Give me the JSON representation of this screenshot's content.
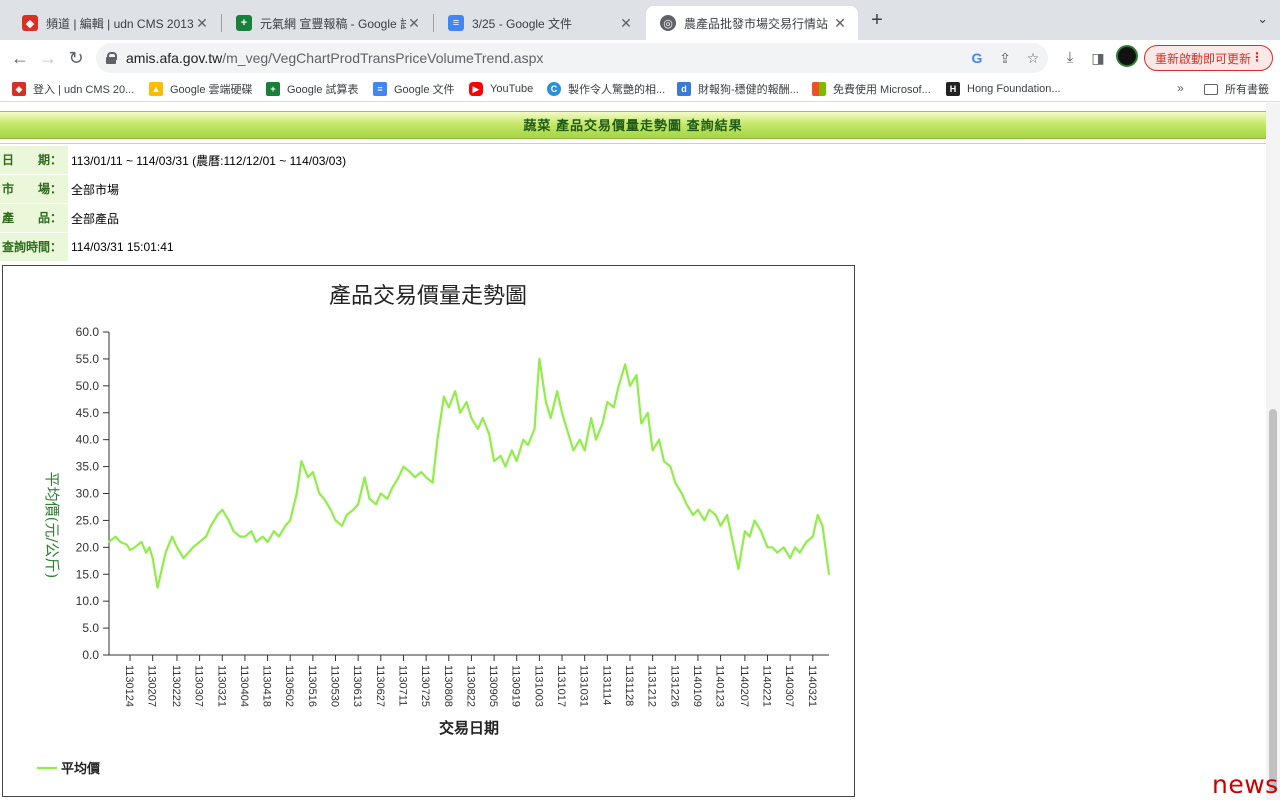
{
  "browser": {
    "tabs": [
      {
        "title": "頻道 | 編輯 | udn CMS 2013",
        "icon": "udn-icon",
        "color": "#d93025"
      },
      {
        "title": "元氣網 宣豐報稿 - Google 試算表",
        "icon": "sheets-icon",
        "color": "#188038"
      },
      {
        "title": "3/25 - Google 文件",
        "icon": "docs-icon",
        "color": "#4285f4"
      },
      {
        "title": "農產品批發市場交易行情站",
        "icon": "globe-icon",
        "color": "#5f6368"
      }
    ],
    "url_host": "amis.afa.gov.tw",
    "url_path": "/m_veg/VegChartProdTransPriceVolumeTrend.aspx",
    "update_label": "重新啟動即可更新",
    "bookmarks": [
      {
        "label": "登入 | udn CMS 20...",
        "icon": "udn-icon",
        "color": "#d93025"
      },
      {
        "label": "Google 雲端硬碟",
        "icon": "drive-icon",
        "color": "#fbbc04"
      },
      {
        "label": "Google 試算表",
        "icon": "sheets-icon",
        "color": "#188038"
      },
      {
        "label": "Google 文件",
        "icon": "docs-icon",
        "color": "#4285f4"
      },
      {
        "label": "YouTube",
        "icon": "youtube-icon",
        "color": "#ff0000"
      },
      {
        "label": "製作令人驚艷的相...",
        "icon": "canva-icon",
        "color": "#2b8fe0"
      },
      {
        "label": "財報狗-穩健的報酬...",
        "icon": "statementdog-icon",
        "color": "#3a7bd5"
      },
      {
        "label": "免費使用 Microsof...",
        "icon": "microsoft-icon",
        "color": "#f25022"
      },
      {
        "label": "Hong Foundation...",
        "icon": "hong-icon",
        "color": "#222222"
      }
    ],
    "all_bookmarks_label": "所有書籤"
  },
  "page": {
    "header": "蔬菜 產品交易價量走勢圖 查詢結果",
    "fields": [
      {
        "label": "日　　期：",
        "value": "113/01/11 ~ 114/03/31 (農曆:112/12/01 ~ 114/03/03)"
      },
      {
        "label": "市　　場：",
        "value": "全部市場"
      },
      {
        "label": "產　　品：",
        "value": "全部產品"
      },
      {
        "label": "查詢時間：",
        "value": "114/03/31 15:01:41"
      }
    ]
  },
  "chart_data": {
    "type": "line",
    "title": "產品交易價量走勢圖",
    "xlabel": "交易日期",
    "ylabel": "平均價(元/公斤)",
    "ylim": [
      0,
      60
    ],
    "ytick_step": 5,
    "grid": false,
    "legend_position": "bottom-left",
    "line_color": "#90ee48",
    "x_ticks": [
      "1130124",
      "1130207",
      "1130222",
      "1130307",
      "1130321",
      "1130404",
      "1130418",
      "1130502",
      "1130516",
      "1130530",
      "1130613",
      "1130627",
      "1130711",
      "1130725",
      "1130808",
      "1130822",
      "1130905",
      "1130919",
      "1131003",
      "1131017",
      "1131031",
      "1131114",
      "1131128",
      "1131212",
      "1131226",
      "1140109",
      "1140123",
      "1140207",
      "1140221",
      "1140307",
      "1140321"
    ],
    "x_tick_labels": [
      "113/01/24",
      "113/02/07",
      "113/02/22",
      "113/03/07",
      "113/03/21",
      "113/04/04",
      "113/04/18",
      "113/05/02",
      "113/05/16",
      "113/05/30",
      "113/06/13",
      "113/06/27",
      "113/07/11",
      "113/07/25",
      "113/08/08",
      "113/08/22",
      "113/09/05",
      "113/09/19",
      "113/10/03",
      "113/10/17",
      "113/10/31",
      "113/11/14",
      "113/11/28",
      "113/12/12",
      "113/12/26",
      "114/01/09",
      "114/01/23",
      "114/02/07",
      "114/02/21",
      "114/03/07",
      "114/03/21"
    ],
    "series": [
      {
        "name": "平均價",
        "x": [
          "1130111",
          "1130115",
          "1130118",
          "1130122",
          "1130124",
          "1130127",
          "1130131",
          "1130203",
          "1130205",
          "1130207",
          "1130210",
          "1130215",
          "1130219",
          "1130222",
          "1130226",
          "1130229",
          "1130303",
          "1130307",
          "1130311",
          "1130314",
          "1130318",
          "1130321",
          "1130325",
          "1130328",
          "1130401",
          "1130404",
          "1130408",
          "1130411",
          "1130415",
          "1130418",
          "1130422",
          "1130425",
          "1130429",
          "1130502",
          "1130506",
          "1130509",
          "1130513",
          "1130516",
          "1130520",
          "1130523",
          "1130527",
          "1130530",
          "1130603",
          "1130606",
          "1130610",
          "1130613",
          "1130617",
          "1130620",
          "1130624",
          "1130627",
          "1130701",
          "1130704",
          "1130708",
          "1130711",
          "1130715",
          "1130718",
          "1130722",
          "1130725",
          "1130729",
          "1130801",
          "1130805",
          "1130808",
          "1130812",
          "1130815",
          "1130819",
          "1130822",
          "1130826",
          "1130829",
          "1130902",
          "1130905",
          "1130909",
          "1130912",
          "1130916",
          "1130919",
          "1130923",
          "1130926",
          "1130930",
          "1131003",
          "1131007",
          "1131010",
          "1131014",
          "1131017",
          "1131021",
          "1131024",
          "1131028",
          "1131031",
          "1131104",
          "1131107",
          "1131111",
          "1131114",
          "1131118",
          "1131121",
          "1131125",
          "1131128",
          "1131202",
          "1131205",
          "1131209",
          "1131212",
          "1131216",
          "1131219",
          "1131223",
          "1131226",
          "1131230",
          "1140102",
          "1140106",
          "1140109",
          "1140113",
          "1140116",
          "1140120",
          "1140123",
          "1140127",
          "1140203",
          "1140207",
          "1140210",
          "1140213",
          "1140217",
          "1140221",
          "1140224",
          "1140227",
          "1140303",
          "1140307",
          "1140310",
          "1140313",
          "1140317",
          "1140321",
          "1140324",
          "1140327",
          "1140331"
        ],
        "values": [
          21,
          22,
          21,
          20.5,
          19.5,
          20,
          21,
          19,
          20,
          18,
          12.5,
          19,
          22,
          20,
          18,
          19,
          20,
          21,
          22,
          24,
          26,
          27,
          25,
          23,
          22,
          22,
          23,
          21,
          22,
          21,
          23,
          22,
          24,
          25,
          30,
          36,
          33,
          34,
          30,
          29,
          27,
          25,
          24,
          26,
          27,
          28,
          33,
          29,
          28,
          30,
          29,
          31,
          33,
          35,
          34,
          33,
          34,
          33,
          32,
          40,
          48,
          46,
          49,
          45,
          47,
          44,
          42,
          44,
          41,
          36,
          37,
          35,
          38,
          36,
          40,
          39,
          42,
          55,
          47,
          44,
          49,
          45,
          41,
          38,
          40,
          38,
          44,
          40,
          43,
          47,
          46,
          50,
          54,
          50,
          52,
          43,
          45,
          38,
          40,
          36,
          35,
          32,
          30,
          28,
          26,
          27,
          25,
          27,
          26,
          24,
          26,
          16,
          23,
          22,
          25,
          23,
          20,
          20,
          19,
          20,
          18,
          20,
          19,
          21,
          22,
          26,
          24,
          15
        ]
      }
    ]
  }
}
